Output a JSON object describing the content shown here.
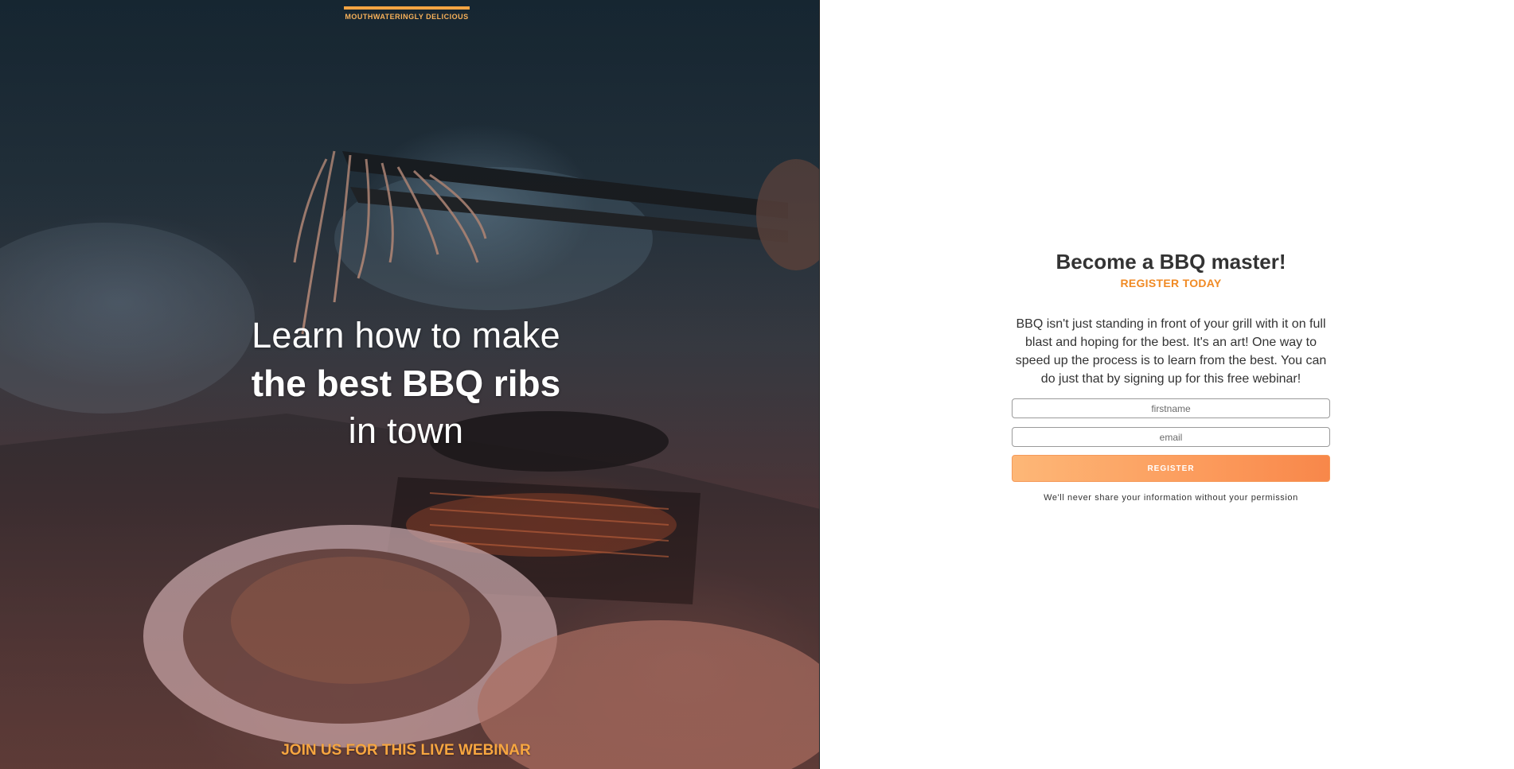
{
  "hero": {
    "brand_tagline": "MOUTHWATERINGLY DELICIOUS",
    "headline_line1": "Learn how to make",
    "headline_line2": "the best BBQ ribs",
    "headline_line3": "in town",
    "bottom_cta": "JOIN US FOR THIS LIVE WEBINAR"
  },
  "form": {
    "title": "Become a BBQ master!",
    "subtitle": "REGISTER TODAY",
    "description": "BBQ isn't just standing in front of your grill with it on full blast and hoping for the best. It's an art! One way to speed up the process is to learn from the best. You can do just that by signing up for this free webinar!",
    "firstname_placeholder": "firstname",
    "firstname_value": "",
    "email_placeholder": "email",
    "email_value": "",
    "register_label": "REGISTER",
    "privacy_note": "We'll never share your information without your permission"
  },
  "colors": {
    "accent": "#f08a24",
    "button_gradient_start": "#fdb777",
    "button_gradient_end": "#f8874a",
    "brand_bar": "#f5a442",
    "text_dark": "#333333"
  }
}
